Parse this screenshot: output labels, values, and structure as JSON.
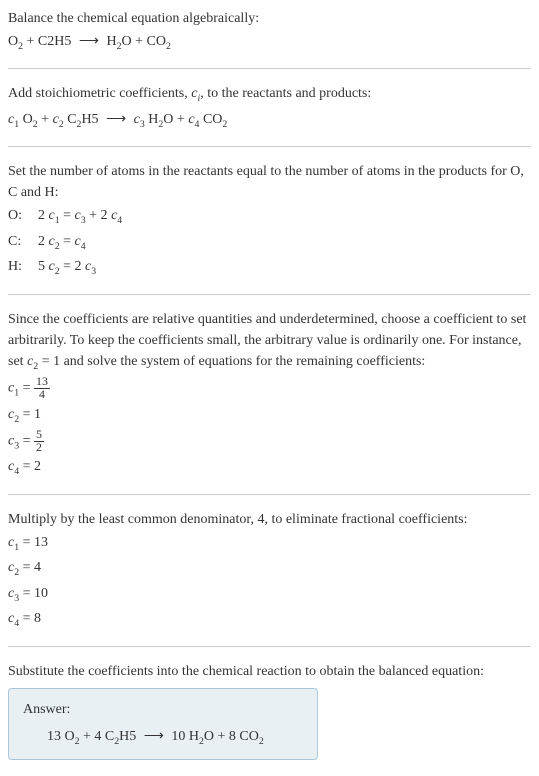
{
  "section1": {
    "text": "Balance the chemical equation algebraically:",
    "equation": "O₂ + C2H5 ⟶ H₂O + CO₂"
  },
  "section2": {
    "text_part1": "Add stoichiometric coefficients, ",
    "text_ci": "cᵢ",
    "text_part2": ", to the reactants and products:",
    "equation": "c₁ O₂ + c₂ C₂H5 ⟶ c₃ H₂O + c₄ CO₂"
  },
  "section3": {
    "text": "Set the number of atoms in the reactants equal to the number of atoms in the products for O, C and H:",
    "rows": [
      {
        "label": "O:",
        "eq": "2 c₁ = c₃ + 2 c₄"
      },
      {
        "label": "C:",
        "eq": "2 c₂ = c₄"
      },
      {
        "label": "H:",
        "eq": "5 c₂ = 2 c₃"
      }
    ]
  },
  "section4": {
    "text_part1": "Since the coefficients are relative quantities and underdetermined, choose a coefficient to set arbitrarily. To keep the coefficients small, the arbitrary value is ordinarily one. For instance, set ",
    "text_c2": "c₂ = 1",
    "text_part2": " and solve the system of equations for the remaining coefficients:",
    "c1_label": "c₁ = ",
    "c1_num": "13",
    "c1_den": "4",
    "c2": "c₂ = 1",
    "c3_label": "c₃ = ",
    "c3_num": "5",
    "c3_den": "2",
    "c4": "c₄ = 2"
  },
  "section5": {
    "text": "Multiply by the least common denominator, 4, to eliminate fractional coefficients:",
    "c1": "c₁ = 13",
    "c2": "c₂ = 4",
    "c3": "c₃ = 10",
    "c4": "c₄ = 8"
  },
  "section6": {
    "text": "Substitute the coefficients into the chemical reaction to obtain the balanced equation:",
    "answer_label": "Answer:",
    "answer": "13 O₂ + 4 C₂H5 ⟶ 10 H₂O + 8 CO₂"
  }
}
